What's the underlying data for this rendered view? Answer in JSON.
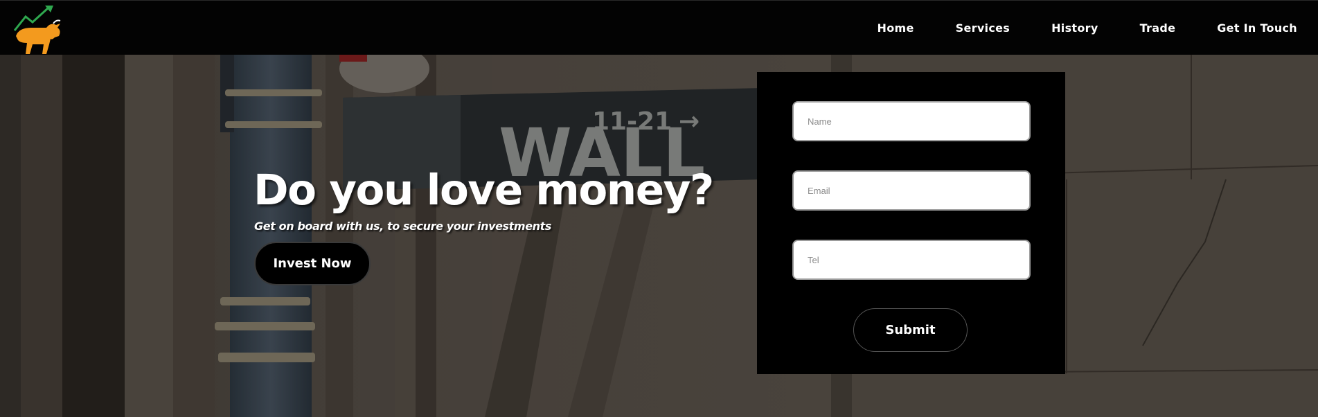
{
  "header": {
    "logo_icon": "bull-with-rising-chart-logo",
    "nav": [
      {
        "label": "Home"
      },
      {
        "label": "Services"
      },
      {
        "label": "History"
      },
      {
        "label": "Trade"
      },
      {
        "label": "Get In Touch"
      }
    ]
  },
  "hero": {
    "background": "wall-street-sign-photo",
    "sign_text": "WALL",
    "sign_number": "11-21",
    "headline": "Do you love money?",
    "subline": "Get on board with us, to secure your investments",
    "cta_label": "Invest Now"
  },
  "form": {
    "name_placeholder": "Name",
    "email_placeholder": "Email",
    "tel_placeholder": "Tel",
    "submit_label": "Submit"
  },
  "colors": {
    "header_bg": "#030303",
    "logo_bull": "#f39a1e",
    "logo_chart": "#2fa84f",
    "form_bg": "#000000",
    "button_bg": "#000000"
  }
}
